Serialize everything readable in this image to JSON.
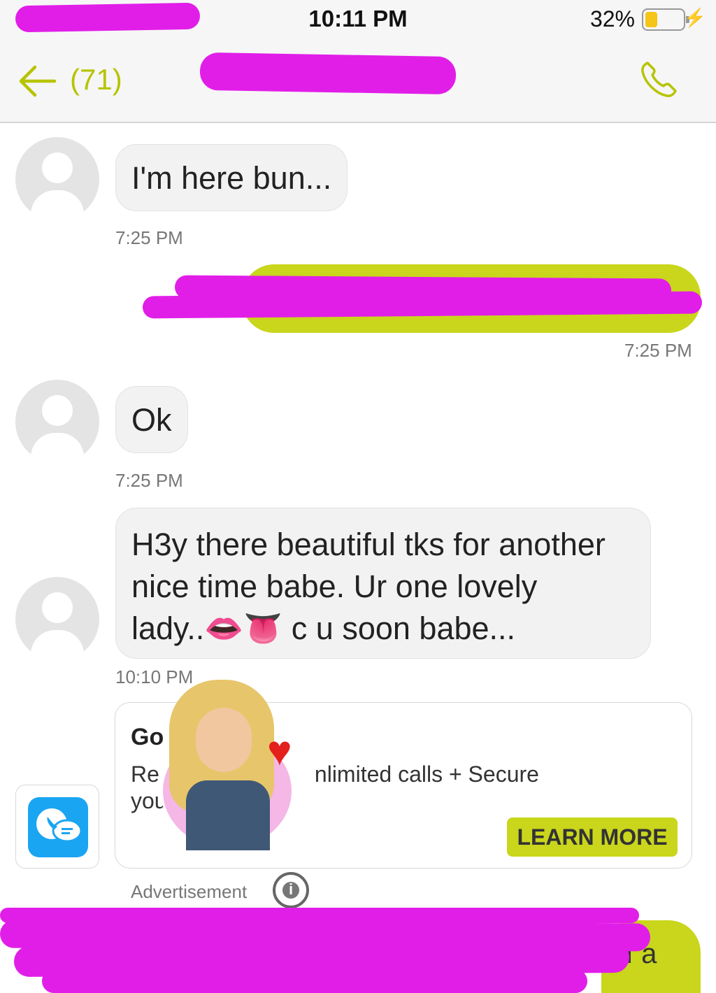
{
  "status_bar": {
    "time": "10:11 PM",
    "battery_percent": "32%",
    "battery_level": 0.32
  },
  "header": {
    "unread_count": "(71)",
    "icons": [
      "back-arrow-icon",
      "phone-icon"
    ]
  },
  "messages": [
    {
      "direction": "incoming",
      "text": "I'm here bun...",
      "time": "7:25 PM"
    },
    {
      "direction": "outgoing",
      "text": "",
      "time": "7:25 PM"
    },
    {
      "direction": "incoming",
      "text": "Ok",
      "time": "7:25 PM"
    },
    {
      "direction": "incoming",
      "line1": "H3y there beautiful tks for another",
      "line2": "nice time babe. Ur one lovely",
      "line3_start": "lady..",
      "emoji1": "👄",
      "emoji2": "👅",
      "line3_end": "c u soon babe...",
      "time": "10:10 PM"
    }
  ],
  "ad": {
    "title": "Go",
    "desc_line1_start": "Re",
    "desc_line1_end": "nlimited calls + Secure",
    "desc_line2": "you",
    "cta": "LEARN MORE",
    "label": "Advertisement",
    "info_glyph": "i"
  },
  "bottom_fragment": "if a",
  "colors": {
    "accent": "#c9d61c",
    "accent_text": "#b6c400",
    "redaction": "#e11ee8",
    "incoming_bubble": "#f2f2f2"
  }
}
